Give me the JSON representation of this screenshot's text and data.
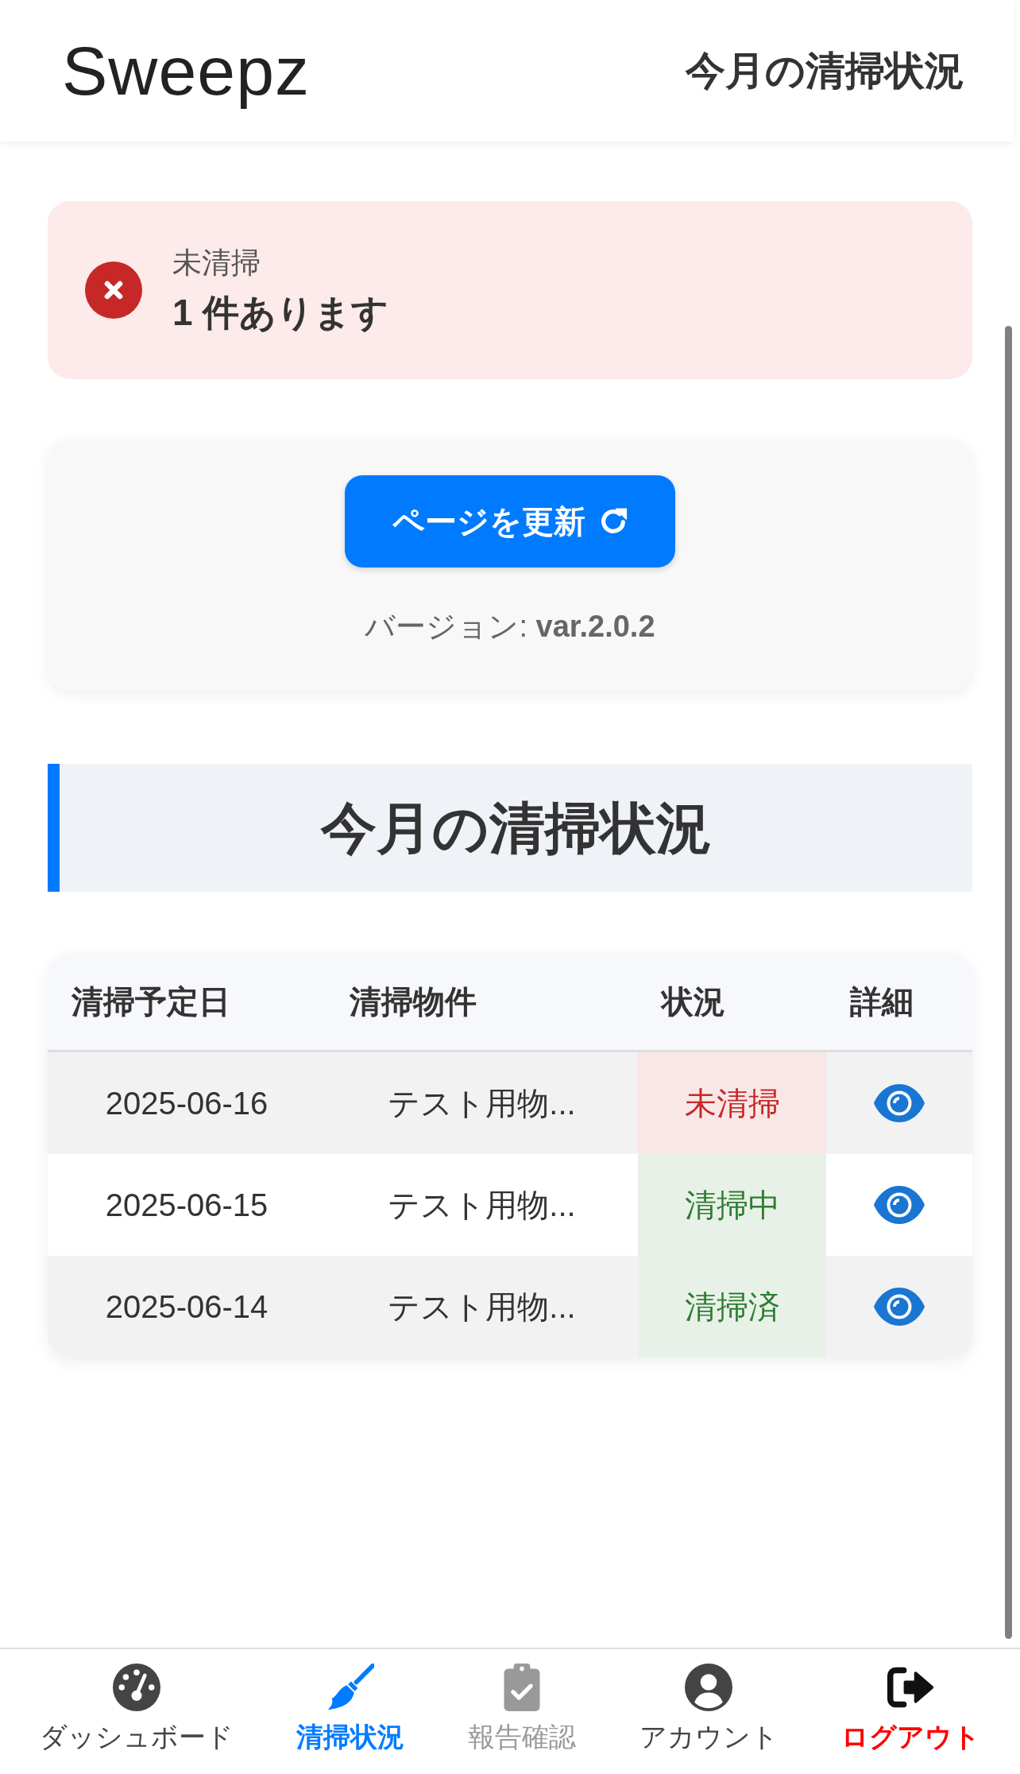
{
  "header": {
    "logo": "Sweepz",
    "title": "今月の清掃状況"
  },
  "alert": {
    "kind": "error",
    "label": "未清掃",
    "message": "1 件あります"
  },
  "refresh_card": {
    "button": "ページを更新",
    "version": "バージョン: **var.2.0.2**"
  },
  "section": {
    "title": "今月の清掃状況"
  },
  "table": {
    "columns": [
      "清掃予定日",
      "清掃物件",
      "状況",
      "詳細"
    ],
    "rows": [
      {
        "date": "2025-06-16",
        "property": "テスト用物...",
        "status": "未清掃",
        "color": "#c62828"
      },
      {
        "date": "2025-06-15",
        "property": "テスト用物...",
        "status": "清掃中",
        "color": "#2e7d32"
      },
      {
        "date": "2025-06-14",
        "property": "テスト用物...",
        "status": "清掃済",
        "color": "#2e7d32"
      }
    ]
  },
  "bottom_nav": {
    "items": [
      {
        "label": "ダッシュボード",
        "kind": "link",
        "selected": false,
        "disabled": false
      },
      {
        "label": "清掃状況",
        "kind": "link",
        "selected": true,
        "disabled": false
      },
      {
        "label": "報告確認",
        "kind": "link",
        "selected": false,
        "disabled": true
      },
      {
        "label": "アカウント",
        "kind": "link",
        "selected": false,
        "disabled": false
      },
      {
        "label": "ログアウト",
        "kind": "logout",
        "selected": false,
        "disabled": false
      }
    ]
  }
}
